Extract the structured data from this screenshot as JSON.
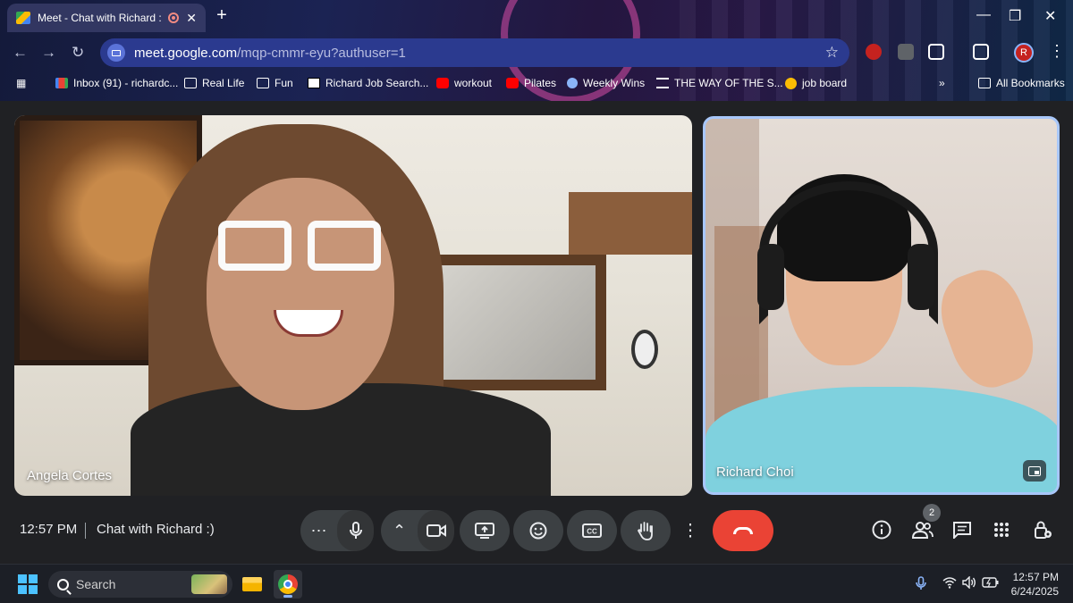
{
  "browser": {
    "tab_title": "Meet - Chat with Richard :)",
    "tab_close": "✕",
    "new_tab": "+",
    "url_host": "meet.google.com",
    "url_path": "/mqp-cmmr-eyu?authuser=1",
    "profile_initial": "R",
    "bookmarks": [
      {
        "label": "Inbox (91) - richardc...",
        "icon": "gmail-icon"
      },
      {
        "label": "Real Life",
        "icon": "folder-icon"
      },
      {
        "label": "Fun",
        "icon": "folder-icon"
      },
      {
        "label": "Richard Job Search...",
        "icon": "notion-icon"
      },
      {
        "label": "workout",
        "icon": "youtube-icon"
      },
      {
        "label": "Pilates",
        "icon": "youtube-icon"
      },
      {
        "label": "Weekly Wins",
        "icon": "people-icon"
      },
      {
        "label": "THE WAY OF THE S...",
        "icon": "bank-icon"
      },
      {
        "label": "job board",
        "icon": "coin-icon"
      }
    ],
    "more_bookmarks": "»",
    "all_bookmarks": "All Bookmarks"
  },
  "meet": {
    "participants": [
      {
        "name": "Angela Cortes"
      },
      {
        "name": "Richard Choi"
      }
    ],
    "time": "12:57 PM",
    "meeting_name": "Chat with Richard :)",
    "people_count": "2"
  },
  "taskbar": {
    "search_label": "Search",
    "time": "12:57 PM",
    "date": "6/24/2025"
  },
  "colors": {
    "meet_background": "#202124",
    "control_button": "#3c4043",
    "hangup": "#ea4335",
    "active_speaker_border": "#a8c7fa"
  }
}
